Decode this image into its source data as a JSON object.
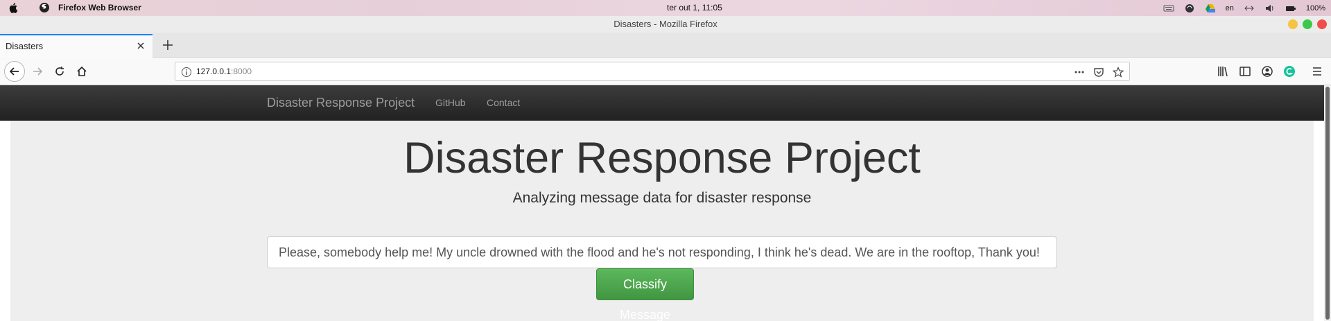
{
  "os_menubar": {
    "app_name": "Firefox Web Browser",
    "clock": "ter out  1, 11:05",
    "language": "en",
    "battery": "100%"
  },
  "window": {
    "title": "Disasters - Mozilla Firefox"
  },
  "tabs": [
    {
      "label": "Disasters",
      "active": true
    }
  ],
  "address_bar": {
    "host": "127.0.0.1",
    "port": ":8000"
  },
  "site": {
    "brand": "Disaster Response Project",
    "nav_links": [
      "GitHub",
      "Contact"
    ],
    "headline": "Disaster Response Project",
    "subtitle": "Analyzing message data for disaster response",
    "query_value": "Please, somebody help me! My uncle drowned with the flood and he's not responding, I think he's dead. We are in the rooftop, Thank you!",
    "classify_label": "Classify Message"
  },
  "colors": {
    "tab_accent": "#0a84ff",
    "navbar_dark": "#222222",
    "jumbotron_bg": "#eeeeee",
    "button_green": "#5cb85c"
  },
  "icons": [
    "apple-icon",
    "firefox-icon",
    "close-icon",
    "plus-icon",
    "back-icon",
    "forward-icon",
    "reload-icon",
    "home-icon",
    "info-icon",
    "more-icon",
    "pocket-icon",
    "star-icon",
    "library-icon",
    "sidebar-icon",
    "account-icon",
    "grammarly-icon",
    "menu-icon"
  ]
}
